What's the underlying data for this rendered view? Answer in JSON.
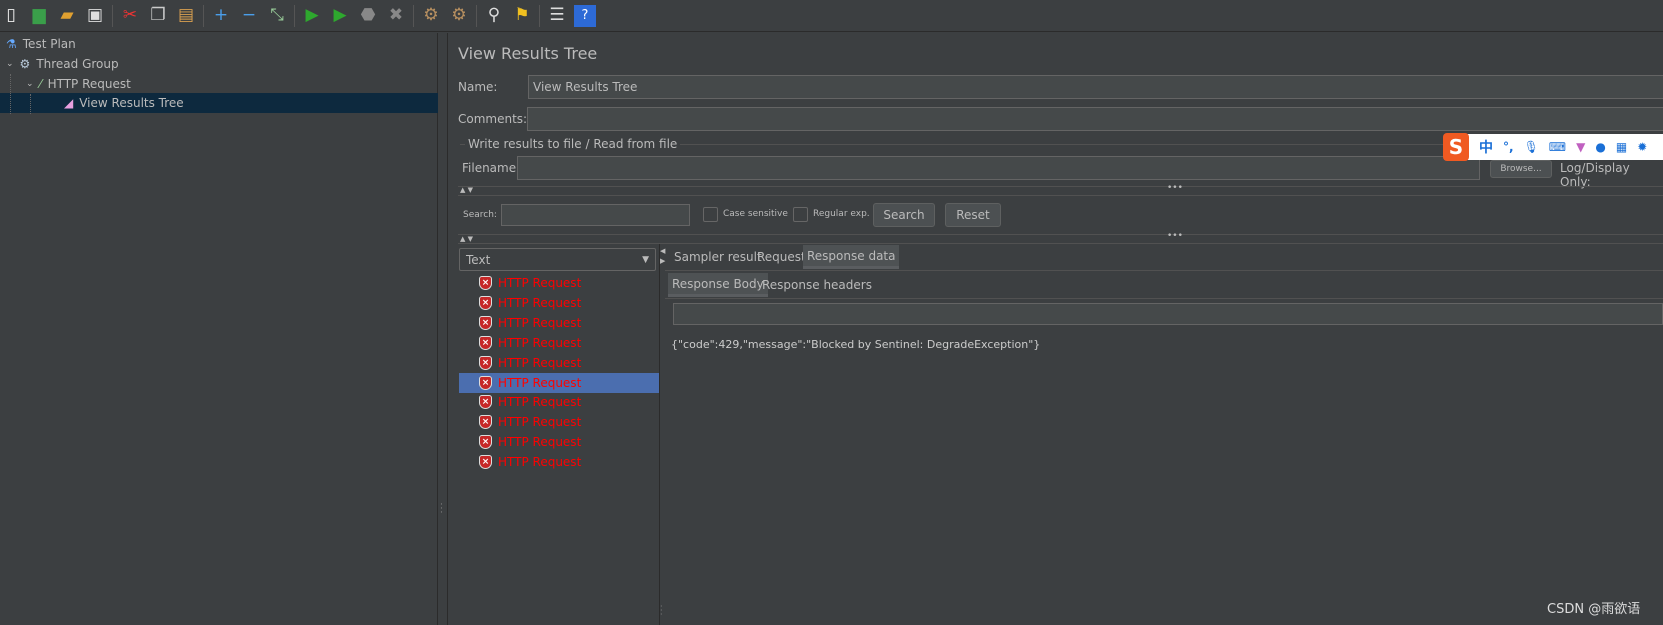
{
  "toolbar": {
    "icons": [
      "new-icon",
      "templates-icon",
      "open-icon",
      "save-icon",
      "cut-icon",
      "copy-icon",
      "paste-icon",
      "expand-icon",
      "collapse-icon",
      "toggle-icon",
      "start-icon",
      "start-no-pause-icon",
      "stop-icon",
      "shutdown-icon",
      "clear-icon",
      "clear-all-icon",
      "search-icon",
      "reset-search-icon",
      "function-helper-icon",
      "help-icon"
    ]
  },
  "tree": {
    "items": [
      {
        "label": "Test Plan"
      },
      {
        "label": "Thread Group"
      },
      {
        "label": "HTTP Request"
      },
      {
        "label": "View Results Tree"
      }
    ]
  },
  "panel": {
    "title": "View Results Tree",
    "name_label": "Name:",
    "name_value": "View Results Tree",
    "comments_label": "Comments:",
    "comments_value": "",
    "file_section": "Write results to file / Read from file",
    "filename_label": "Filename",
    "filename_value": "",
    "browse": "Browse...",
    "log_display": "Log/Display Only:",
    "search_label": "Search:",
    "search_value": "",
    "case_sensitive": "Case sensitive",
    "regex": "Regular exp.",
    "search_btn": "Search",
    "reset_btn": "Reset",
    "renderer": "Text",
    "results": [
      "HTTP Request",
      "HTTP Request",
      "HTTP Request",
      "HTTP Request",
      "HTTP Request",
      "HTTP Request",
      "HTTP Request",
      "HTTP Request",
      "HTTP Request",
      "HTTP Request"
    ],
    "selected_index": 5,
    "tabs": [
      "Sampler result",
      "Request",
      "Response data"
    ],
    "active_tab": "Response data",
    "subtabs": [
      "Response Body",
      "Response headers"
    ],
    "active_subtab": "Response Body",
    "response_body": "{\"code\":429,\"message\":\"Blocked by Sentinel: DegradeException\"}"
  },
  "ime": {
    "items": [
      "中",
      "°,"
    ]
  },
  "watermark": "CSDN @雨欲语",
  "colors": {
    "error": "#ff0000",
    "selected": "#4b6eaf",
    "tree_selected": "#0d293e"
  }
}
